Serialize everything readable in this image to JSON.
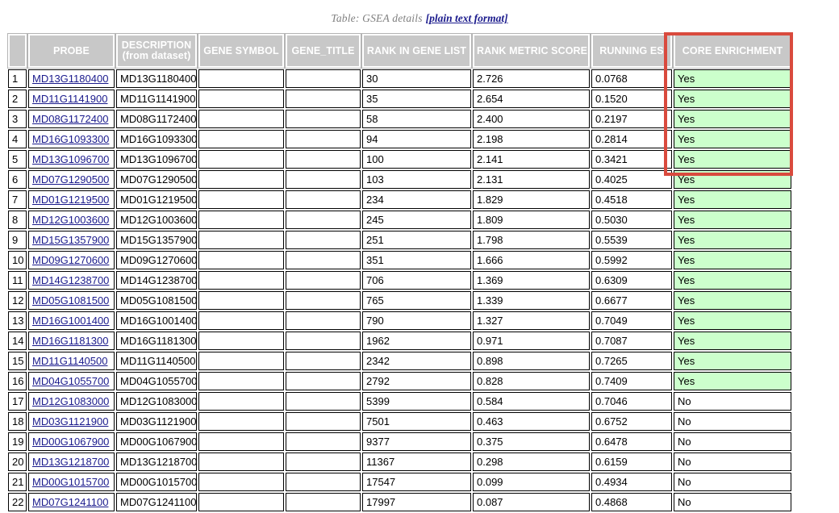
{
  "caption": {
    "text": "Table: GSEA details",
    "link_label": "[plain text format]"
  },
  "table": {
    "columns": [
      {
        "key": "index",
        "label": ""
      },
      {
        "key": "probe",
        "label": "PROBE"
      },
      {
        "key": "description",
        "label": "DESCRIPTION",
        "sublabel": "(from dataset)"
      },
      {
        "key": "gene_symbol",
        "label": "GENE SYMBOL"
      },
      {
        "key": "gene_title",
        "label": "GENE_TITLE"
      },
      {
        "key": "rank_in_gene_list",
        "label": "RANK IN GENE LIST"
      },
      {
        "key": "rank_metric_score",
        "label": "RANK METRIC SCORE"
      },
      {
        "key": "running_es",
        "label": "RUNNING ES"
      },
      {
        "key": "core_enrichment",
        "label": "CORE ENRICHMENT"
      }
    ],
    "rows": [
      {
        "index": "1",
        "probe": "MD13G1180400",
        "description": "MD13G1180400",
        "gene_symbol": "",
        "gene_title": "",
        "rank_in_gene_list": "30",
        "rank_metric_score": "2.726",
        "running_es": "0.0768",
        "core_enrichment": "Yes"
      },
      {
        "index": "2",
        "probe": "MD11G1141900",
        "description": "MD11G1141900",
        "gene_symbol": "",
        "gene_title": "",
        "rank_in_gene_list": "35",
        "rank_metric_score": "2.654",
        "running_es": "0.1520",
        "core_enrichment": "Yes"
      },
      {
        "index": "3",
        "probe": "MD08G1172400",
        "description": "MD08G1172400",
        "gene_symbol": "",
        "gene_title": "",
        "rank_in_gene_list": "58",
        "rank_metric_score": "2.400",
        "running_es": "0.2197",
        "core_enrichment": "Yes"
      },
      {
        "index": "4",
        "probe": "MD16G1093300",
        "description": "MD16G1093300",
        "gene_symbol": "",
        "gene_title": "",
        "rank_in_gene_list": "94",
        "rank_metric_score": "2.198",
        "running_es": "0.2814",
        "core_enrichment": "Yes"
      },
      {
        "index": "5",
        "probe": "MD13G1096700",
        "description": "MD13G1096700",
        "gene_symbol": "",
        "gene_title": "",
        "rank_in_gene_list": "100",
        "rank_metric_score": "2.141",
        "running_es": "0.3421",
        "core_enrichment": "Yes"
      },
      {
        "index": "6",
        "probe": "MD07G1290500",
        "description": "MD07G1290500",
        "gene_symbol": "",
        "gene_title": "",
        "rank_in_gene_list": "103",
        "rank_metric_score": "2.131",
        "running_es": "0.4025",
        "core_enrichment": "Yes"
      },
      {
        "index": "7",
        "probe": "MD01G1219500",
        "description": "MD01G1219500",
        "gene_symbol": "",
        "gene_title": "",
        "rank_in_gene_list": "234",
        "rank_metric_score": "1.829",
        "running_es": "0.4518",
        "core_enrichment": "Yes"
      },
      {
        "index": "8",
        "probe": "MD12G1003600",
        "description": "MD12G1003600",
        "gene_symbol": "",
        "gene_title": "",
        "rank_in_gene_list": "245",
        "rank_metric_score": "1.809",
        "running_es": "0.5030",
        "core_enrichment": "Yes"
      },
      {
        "index": "9",
        "probe": "MD15G1357900",
        "description": "MD15G1357900",
        "gene_symbol": "",
        "gene_title": "",
        "rank_in_gene_list": "251",
        "rank_metric_score": "1.798",
        "running_es": "0.5539",
        "core_enrichment": "Yes"
      },
      {
        "index": "10",
        "probe": "MD09G1270600",
        "description": "MD09G1270600",
        "gene_symbol": "",
        "gene_title": "",
        "rank_in_gene_list": "351",
        "rank_metric_score": "1.666",
        "running_es": "0.5992",
        "core_enrichment": "Yes"
      },
      {
        "index": "11",
        "probe": "MD14G1238700",
        "description": "MD14G1238700",
        "gene_symbol": "",
        "gene_title": "",
        "rank_in_gene_list": "706",
        "rank_metric_score": "1.369",
        "running_es": "0.6309",
        "core_enrichment": "Yes"
      },
      {
        "index": "12",
        "probe": "MD05G1081500",
        "description": "MD05G1081500",
        "gene_symbol": "",
        "gene_title": "",
        "rank_in_gene_list": "765",
        "rank_metric_score": "1.339",
        "running_es": "0.6677",
        "core_enrichment": "Yes"
      },
      {
        "index": "13",
        "probe": "MD16G1001400",
        "description": "MD16G1001400",
        "gene_symbol": "",
        "gene_title": "",
        "rank_in_gene_list": "790",
        "rank_metric_score": "1.327",
        "running_es": "0.7049",
        "core_enrichment": "Yes"
      },
      {
        "index": "14",
        "probe": "MD16G1181300",
        "description": "MD16G1181300",
        "gene_symbol": "",
        "gene_title": "",
        "rank_in_gene_list": "1962",
        "rank_metric_score": "0.971",
        "running_es": "0.7087",
        "core_enrichment": "Yes"
      },
      {
        "index": "15",
        "probe": "MD11G1140500",
        "description": "MD11G1140500",
        "gene_symbol": "",
        "gene_title": "",
        "rank_in_gene_list": "2342",
        "rank_metric_score": "0.898",
        "running_es": "0.7265",
        "core_enrichment": "Yes"
      },
      {
        "index": "16",
        "probe": "MD04G1055700",
        "description": "MD04G1055700",
        "gene_symbol": "",
        "gene_title": "",
        "rank_in_gene_list": "2792",
        "rank_metric_score": "0.828",
        "running_es": "0.7409",
        "core_enrichment": "Yes"
      },
      {
        "index": "17",
        "probe": "MD12G1083000",
        "description": "MD12G1083000",
        "gene_symbol": "",
        "gene_title": "",
        "rank_in_gene_list": "5399",
        "rank_metric_score": "0.584",
        "running_es": "0.7046",
        "core_enrichment": "No"
      },
      {
        "index": "18",
        "probe": "MD03G1121900",
        "description": "MD03G1121900",
        "gene_symbol": "",
        "gene_title": "",
        "rank_in_gene_list": "7501",
        "rank_metric_score": "0.463",
        "running_es": "0.6752",
        "core_enrichment": "No"
      },
      {
        "index": "19",
        "probe": "MD00G1067900",
        "description": "MD00G1067900",
        "gene_symbol": "",
        "gene_title": "",
        "rank_in_gene_list": "9377",
        "rank_metric_score": "0.375",
        "running_es": "0.6478",
        "core_enrichment": "No"
      },
      {
        "index": "20",
        "probe": "MD13G1218700",
        "description": "MD13G1218700",
        "gene_symbol": "",
        "gene_title": "",
        "rank_in_gene_list": "11367",
        "rank_metric_score": "0.298",
        "running_es": "0.6159",
        "core_enrichment": "No"
      },
      {
        "index": "21",
        "probe": "MD00G1015700",
        "description": "MD00G1015700",
        "gene_symbol": "",
        "gene_title": "",
        "rank_in_gene_list": "17547",
        "rank_metric_score": "0.099",
        "running_es": "0.4934",
        "core_enrichment": "No"
      },
      {
        "index": "22",
        "probe": "MD07G1241100",
        "description": "MD07G1241100",
        "gene_symbol": "",
        "gene_title": "",
        "rank_in_gene_list": "17997",
        "rank_metric_score": "0.087",
        "running_es": "0.4868",
        "core_enrichment": "No"
      }
    ]
  },
  "annotation": {
    "highlight_color": "#d94a3d"
  },
  "colors": {
    "header_background": "#c8c8c8",
    "core_enrichment_yes_background": "#ccffcc",
    "link": "#1a1a8c"
  }
}
